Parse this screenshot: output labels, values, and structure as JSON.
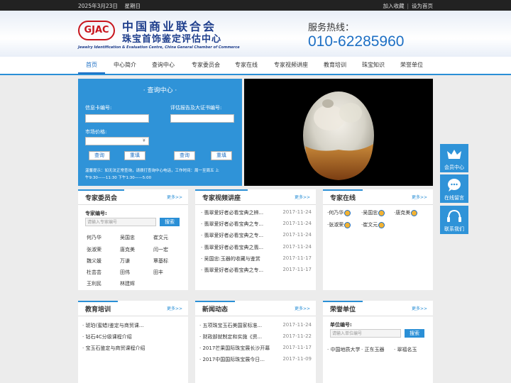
{
  "topbar": {
    "date": "2025年3月23日",
    "weekday": "星期日",
    "links": [
      "加入收藏",
      "设为首页"
    ]
  },
  "header": {
    "logo_abbr": "GJAC",
    "logo_cn_line1": "中国商业联合会",
    "logo_cn_line2": "珠宝首饰鉴定评估中心",
    "logo_en": "Jewelry Identification & Evaluation Centre, China General Chamber of Commerce",
    "hotline_label": "服务热线：",
    "hotline_number": "010-62285960"
  },
  "nav": [
    "首页",
    "中心简介",
    "查询中心",
    "专家委员会",
    "专家在线",
    "专家视频讲座",
    "教育培训",
    "珠宝知识",
    "荣誉单位"
  ],
  "query": {
    "title": "· 查询中心 ·",
    "card_label": "信息卡编号:",
    "report_label": "评估报告及大证书编号:",
    "price_label": "市场价格:",
    "currency": "¥",
    "btn_query": "查询",
    "btn_reset": "重填",
    "tip_line1": "温馨提示：如无法正常查询，请拨打查询中心电话，工作时间：周一至周五  上",
    "tip_line2": "午9:30——11:30  下午1:30——5:00"
  },
  "experts": {
    "title": "专家委员会",
    "more": "更多>>",
    "id_label": "专家编号:",
    "placeholder": "请输入专家编号",
    "search": "搜索",
    "names": [
      "何乃华",
      "吴国忠",
      "崔文元",
      "张淑荣",
      "唐克美",
      "闫一宏",
      "魏义媛",
      "万谦",
      "覃基标",
      "杜芸芸",
      "田伟",
      "田丰",
      "王利民",
      "林建辉"
    ]
  },
  "video": {
    "title": "专家视频讲座",
    "more": "更多>>",
    "items": [
      {
        "t": "翡翠爱好者必看宝典之辨...",
        "d": "2017-11-24"
      },
      {
        "t": "翡翠爱好者必看宝典之专...",
        "d": "2017-11-24"
      },
      {
        "t": "翡翠爱好者必看宝典之专...",
        "d": "2017-11-24"
      },
      {
        "t": "翡翠爱好者必看宝典之翡...",
        "d": "2017-11-24"
      },
      {
        "t": "吴国忠:玉器的收藏与鉴赏",
        "d": "2017-11-17"
      },
      {
        "t": "翡翠爱好者必看宝典之专...",
        "d": "2017-11-17"
      }
    ]
  },
  "online": {
    "title": "专家在线",
    "more": "更多>>",
    "names": [
      "何乃华",
      "吴国忠",
      "唐克美",
      "张淑荣",
      "崔文元"
    ]
  },
  "education": {
    "title": "教育培训",
    "more": "更多>>",
    "items": [
      "琥珀(蜜蜡)鉴定与商贸课...",
      "钻石4C分级课程介绍",
      "宝玉石鉴定与商贸课程介绍"
    ]
  },
  "news": {
    "title": "新闻动态",
    "more": "更多>>",
    "items": [
      {
        "t": "五项珠宝玉石美国家标准...",
        "d": "2017-11-24"
      },
      {
        "t": "财政部就制定和实施《资...",
        "d": "2017-11-22"
      },
      {
        "t": "2017芒果国际珠宝展长沙开幕",
        "d": "2017-11-17"
      },
      {
        "t": "2017中国国际珠宝展今日...",
        "d": "2017-11-09"
      }
    ]
  },
  "honor": {
    "title": "荣誉单位",
    "more": "更多>>",
    "id_label": "单位编号:",
    "placeholder": "请输入单位编号",
    "search": "搜索",
    "units": [
      "中国地质大学",
      "正东玉器",
      "翠福名玉"
    ]
  },
  "side": [
    "会员中心",
    "在线留言",
    "联系我们"
  ]
}
